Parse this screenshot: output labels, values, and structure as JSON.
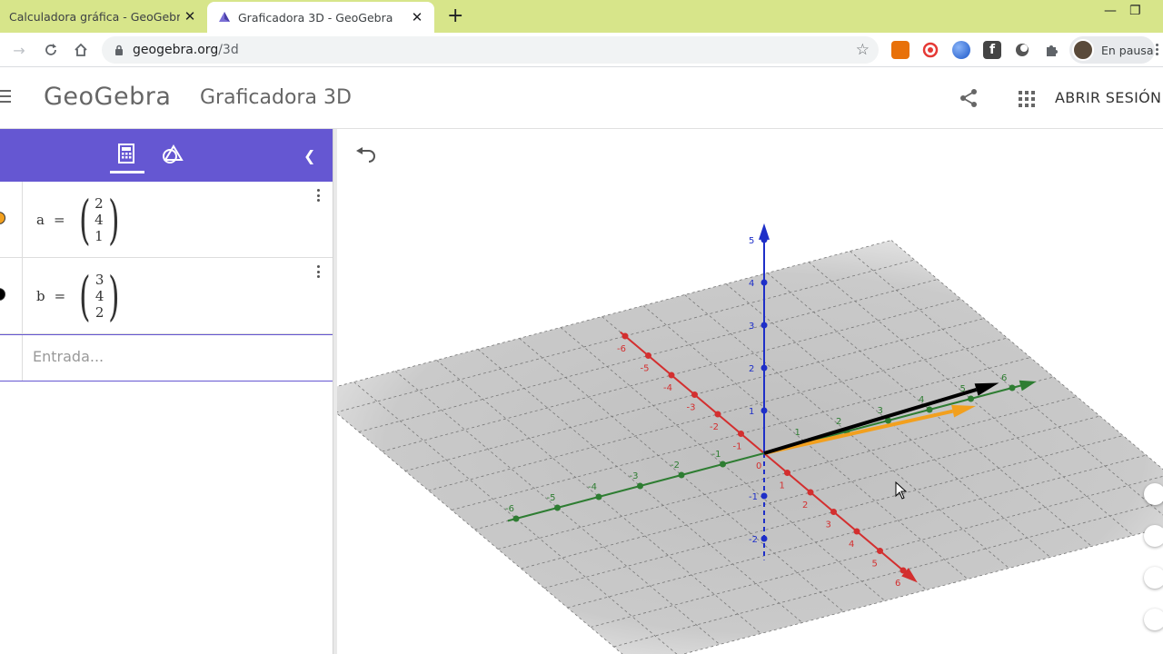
{
  "browser": {
    "tabs": [
      {
        "title": "Calculadora gráfica - GeoGebra",
        "active": false
      },
      {
        "title": "Graficadora 3D - GeoGebra",
        "active": true
      }
    ],
    "url_host": "geogebra.org",
    "url_path": "/3d",
    "profile_label": "En pausa",
    "tabstrip_color": "#d7e58a"
  },
  "header": {
    "logo": "GeoGebra",
    "app_title": "Graficadora 3D",
    "signin_label": "ABRIR SESIÓN"
  },
  "algebra": {
    "accent_color": "#6557d2",
    "items": [
      {
        "name": "a",
        "eq": "=",
        "components": [
          "2",
          "4",
          "1"
        ],
        "color": "#f2a01e"
      },
      {
        "name": "b",
        "eq": "=",
        "components": [
          "3",
          "4",
          "2"
        ],
        "color": "#000000"
      }
    ],
    "input_placeholder": "Entrada..."
  },
  "graph3d": {
    "x_axis_color": "#d32f2f",
    "y_axis_color": "#2e7d32",
    "z_axis_color": "#1e2fc8",
    "x_ticks": [
      "-6",
      "-5",
      "-4",
      "-3",
      "-2",
      "-1",
      "0",
      "1",
      "2",
      "3",
      "4",
      "5",
      "6"
    ],
    "y_ticks": [
      "-6",
      "-5",
      "-4",
      "-3",
      "-2",
      "-1",
      "1",
      "2",
      "3",
      "4",
      "5",
      "6"
    ],
    "z_ticks": [
      "-2",
      "-1",
      "1",
      "2",
      "3",
      "4",
      "5"
    ],
    "vectors": [
      {
        "name": "a",
        "components": [
          2,
          4,
          1
        ],
        "color": "#f2a01e"
      },
      {
        "name": "b",
        "components": [
          3,
          4,
          2
        ],
        "color": "#000000"
      }
    ]
  }
}
